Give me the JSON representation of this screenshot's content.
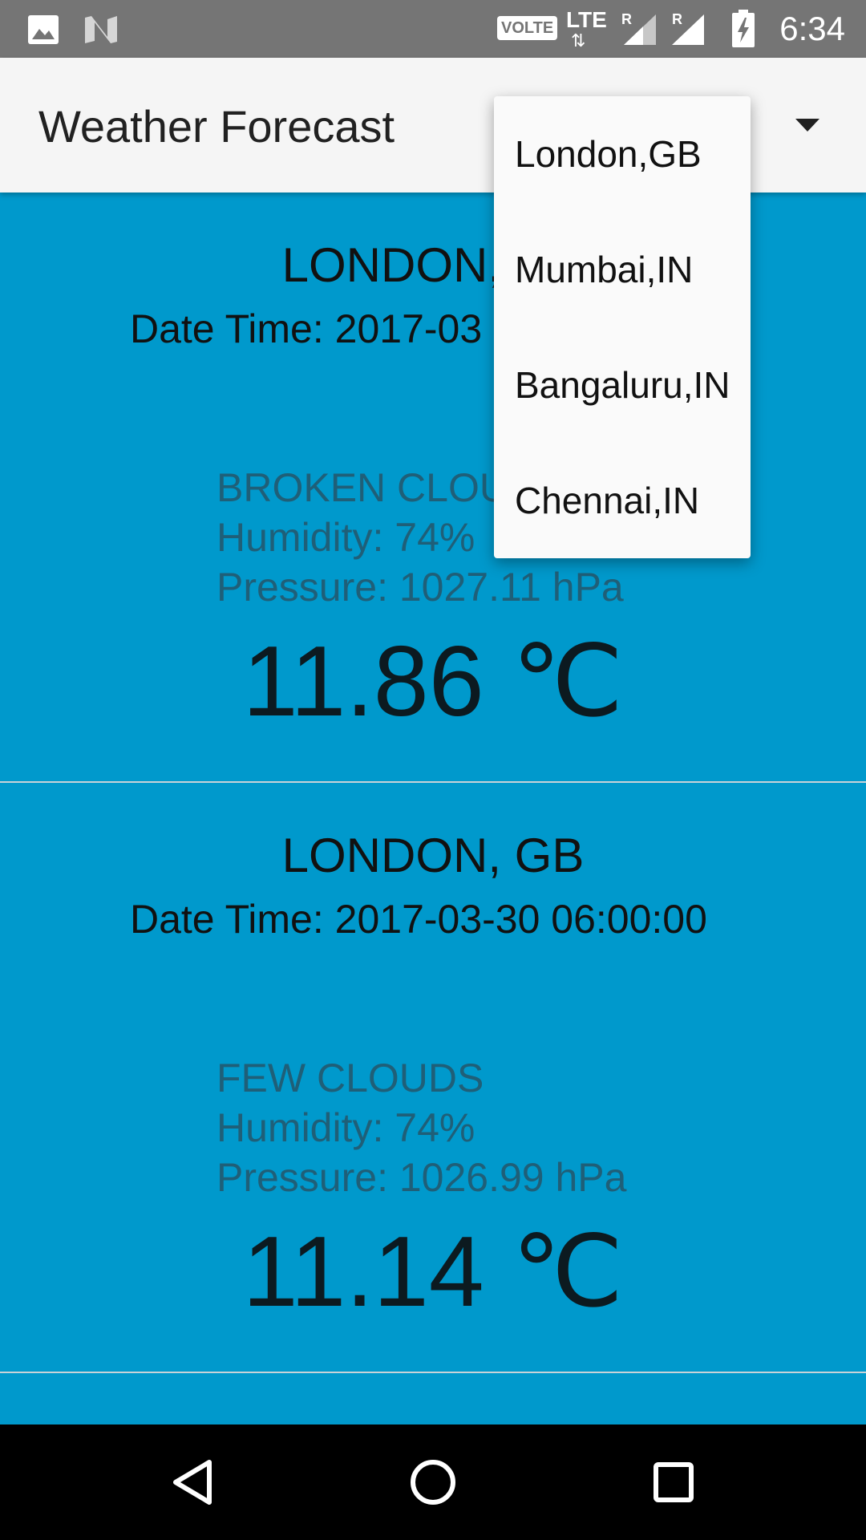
{
  "status_bar": {
    "time": "6:34",
    "volte_label": "VOLTE",
    "network_label": "LTE",
    "roaming_marker": "R",
    "icons": [
      "image-icon",
      "n-logo-icon",
      "volte-icon",
      "lte-icon",
      "signal-icon",
      "signal-icon",
      "battery-charging-icon"
    ]
  },
  "app_bar": {
    "title": "Weather Forecast",
    "spinner_icon": "chevron-down-icon"
  },
  "dropdown": {
    "options": [
      "London,GB",
      "Mumbai,IN",
      "Bangaluru,IN",
      "Chennai,IN"
    ]
  },
  "forecasts": [
    {
      "city": "LONDON, GB",
      "datetime": "Date Time: 2017-03",
      "description": "BROKEN CLOUDS",
      "humidity": "Humidity: 74%",
      "pressure": "Pressure: 1027.11 hPa",
      "temperature": "11.86 ℃"
    },
    {
      "city": "LONDON, GB",
      "datetime": "Date Time: 2017-03-30 06:00:00",
      "description": "FEW CLOUDS",
      "humidity": "Humidity: 74%",
      "pressure": "Pressure: 1026.99 hPa",
      "temperature": "11.14 ℃"
    }
  ],
  "nav_bar": {
    "icons": [
      "back-icon",
      "home-icon",
      "recents-icon"
    ]
  },
  "colors": {
    "list_background": "#0099cc",
    "app_bar": "#f5f5f5",
    "status_bar": "#757575",
    "secondary_text": "#1f5f78"
  }
}
